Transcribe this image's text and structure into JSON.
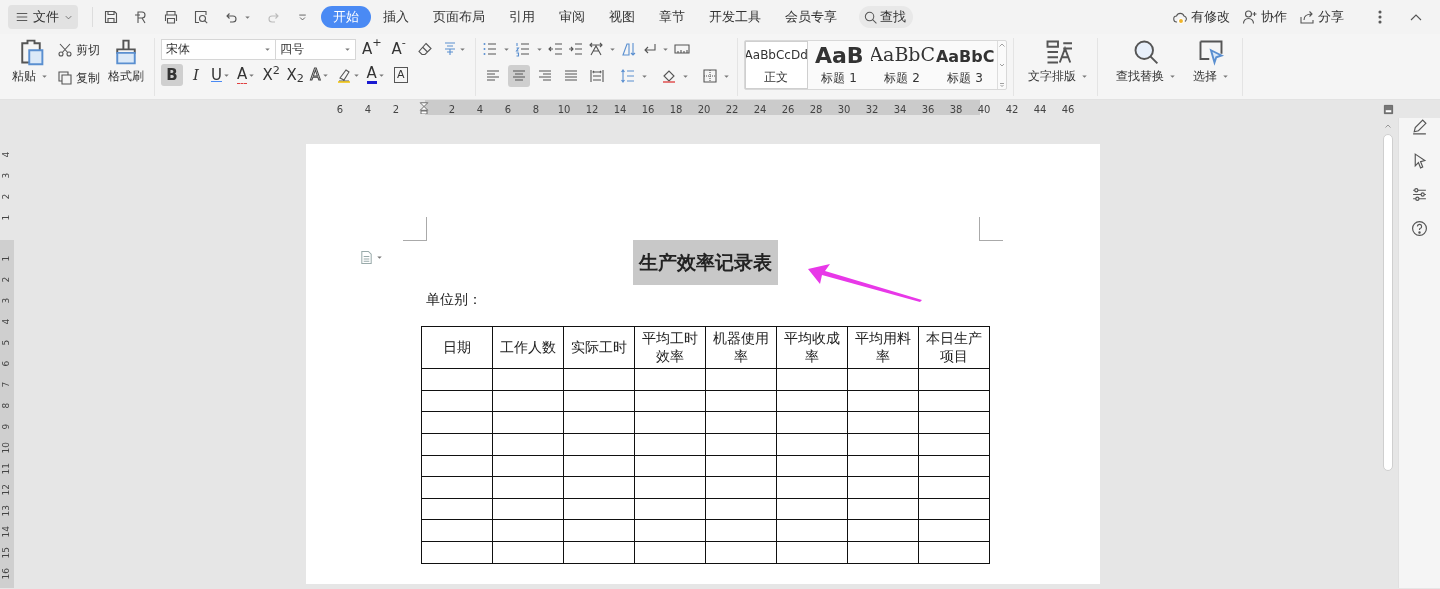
{
  "file_menu": {
    "label": "文件"
  },
  "tabs": [
    {
      "label": "开始",
      "selected": true
    },
    {
      "label": "插入",
      "selected": false
    },
    {
      "label": "页面布局",
      "selected": false
    },
    {
      "label": "引用",
      "selected": false
    },
    {
      "label": "审阅",
      "selected": false
    },
    {
      "label": "视图",
      "selected": false
    },
    {
      "label": "章节",
      "selected": false
    },
    {
      "label": "开发工具",
      "selected": false
    },
    {
      "label": "会员专享",
      "selected": false
    }
  ],
  "search": {
    "label": "查找"
  },
  "top_right": [
    {
      "kind": "cloud",
      "label": "有修改"
    },
    {
      "kind": "person",
      "label": "协作"
    },
    {
      "kind": "share",
      "label": "分享"
    }
  ],
  "clipboard": {
    "paste": "粘贴",
    "cut": "剪切",
    "copy": "复制",
    "format_painter": "格式刷"
  },
  "font": {
    "family": "宋体",
    "size": "四号"
  },
  "size_buttons": [
    {
      "label": "A$^{+}$"
    },
    {
      "label": "A$^{-}$"
    }
  ],
  "format_buttons": [
    {
      "kind": "bold",
      "label": "B",
      "on": true
    },
    {
      "kind": "italic",
      "label": "I",
      "on": false
    },
    {
      "kind": "underline",
      "label": "U",
      "on": false
    },
    {
      "kind": "strikethrough",
      "label": "A",
      "on": false
    },
    {
      "kind": "superscript",
      "label": "X$^{2}$",
      "on": false
    },
    {
      "kind": "subscript",
      "label": "X$_{2}$",
      "on": false
    },
    {
      "kind": "text_effect",
      "label": "A",
      "on": false
    },
    {
      "kind": "highlight",
      "on": false
    },
    {
      "kind": "font_color",
      "label": "A",
      "on": false
    },
    {
      "kind": "char_border",
      "label": "A",
      "on": false
    }
  ],
  "alignment_buttons": [
    {
      "kind": "left",
      "selected": false
    },
    {
      "kind": "center",
      "selected": true
    },
    {
      "kind": "right",
      "selected": false
    },
    {
      "kind": "justify",
      "selected": false
    },
    {
      "kind": "distributed",
      "selected": false
    }
  ],
  "styles": [
    {
      "kind": "body",
      "sample": "AaBbCcDd",
      "label": "正文",
      "selected": true
    },
    {
      "kind": "heading1",
      "sample": "AaB",
      "label": "标题 1",
      "selected": false
    },
    {
      "kind": "heading2",
      "sample": "AaBbC",
      "label": "标题 2",
      "selected": false
    },
    {
      "kind": "heading3",
      "sample": "AaBbC",
      "label": "标题 3",
      "selected": false
    }
  ],
  "tools": [
    {
      "kind": "text_layout",
      "label": "文字排版"
    },
    {
      "kind": "find_replace",
      "label": "查找替换"
    },
    {
      "kind": "select",
      "label": "选择"
    }
  ],
  "ruler": {
    "left_ticks": [
      "6",
      "4",
      "2"
    ],
    "right_ticks": [
      "2",
      "4",
      "6",
      "8",
      "10",
      "12",
      "14",
      "16",
      "18",
      "20",
      "22",
      "24",
      "26",
      "28",
      "30",
      "32",
      "34",
      "36",
      "38",
      "40",
      "42",
      "44",
      "46"
    ]
  },
  "vertical_ruler": {
    "top_ticks": [
      "4",
      "3",
      "2",
      "1"
    ],
    "body_ticks": [
      "1",
      "2",
      "3",
      "4",
      "5",
      "6",
      "7",
      "8",
      "9",
      "10",
      "11",
      "12",
      "13",
      "14",
      "15",
      "16"
    ]
  },
  "document": {
    "title": "生产效率记录表",
    "title_selected": true,
    "unit_label": "单位别：",
    "table": {
      "columns": [
        "日期",
        "工作人数",
        "实际工时",
        "平均工时效率",
        "机器使用率",
        "平均收成率",
        "平均用料率",
        "本日生产项目"
      ],
      "rows": [
        {
          "kind": "blank"
        },
        {
          "kind": "blank"
        },
        {
          "kind": "blank"
        },
        {
          "kind": "blank"
        },
        {
          "kind": "blank"
        },
        {
          "kind": "blank"
        },
        {
          "kind": "blank"
        },
        {
          "kind": "blank"
        },
        {
          "kind": "blank"
        }
      ]
    }
  }
}
